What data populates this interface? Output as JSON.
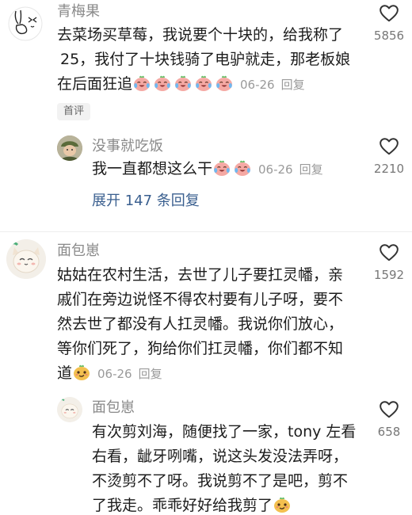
{
  "comments": [
    {
      "author": "青梅果",
      "text_lines": [
        "去菜场买草莓，我说要个十块的，给我称了",
        "25，我付了十块钱骑了电驴就走，那老板娘",
        "在后面狂追"
      ],
      "date": "06-26",
      "reply_label": "回复",
      "likes": "5856",
      "badge": "首评",
      "reply": {
        "author": "没事就吃饭",
        "text": "我一直都想这么干",
        "date": "06-26",
        "reply_label": "回复",
        "likes": "2210"
      },
      "expand_label": "展开 147 条回复"
    },
    {
      "author": "面包崽",
      "text_lines": [
        "姑姑在农村生活，去世了儿子要扛灵幡，亲",
        "戚们在旁边说怪不得农村要有儿子呀，要不",
        "然去世了都没有人扛灵幡。我说你们放心，",
        "等你们死了，狗给你们扛灵幡，你们都不知",
        "道"
      ],
      "date": "06-26",
      "reply_label": "回复",
      "likes": "1592",
      "reply": {
        "author": "面包崽",
        "text_lines": [
          "有次剪刘海，随便找了一家，tony 左看",
          "右看，龇牙咧嘴，说这头发没法弄呀，",
          "不烫剪不了呀。我说剪不了是吧，剪不",
          "了我走。乖乖好好给我剪了"
        ],
        "likes": "658"
      }
    }
  ],
  "icons": {
    "like": "heart-outline-icon",
    "cry_laugh": "crying-laughing-emoji-icon",
    "smug": "smug-face-emoji-icon"
  },
  "colors": {
    "name": "#8a8a8a",
    "link": "#3a5f8f",
    "meta": "#9a9a9a"
  }
}
